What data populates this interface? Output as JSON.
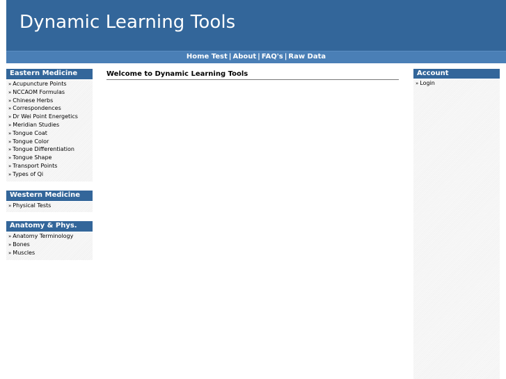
{
  "site": {
    "title": "Dynamic Learning Tools"
  },
  "nav": {
    "items": [
      {
        "label": "Home Test"
      },
      {
        "label": "About"
      },
      {
        "label": "FAQ's"
      },
      {
        "label": "Raw Data"
      }
    ],
    "separator": "|"
  },
  "sidebar_left": {
    "sections": [
      {
        "title": "Eastern Medicine",
        "items": [
          "Acupuncture Points",
          "NCCAOM Formulas",
          "Chinese Herbs",
          "Correspondences",
          "Dr Wei Point Energetics",
          "Meridian Studies",
          "Tongue Coat",
          "Tongue Color",
          "Tongue Differentiation",
          "Tongue Shape",
          "Transport Points",
          "Types of Qi"
        ]
      },
      {
        "title": "Western Medicine",
        "items": [
          "Physical Tests"
        ]
      },
      {
        "title": "Anatomy & Phys.",
        "items": [
          "Anatomy Terminology",
          "Bones",
          "Muscles"
        ]
      }
    ]
  },
  "main": {
    "heading": "Welcome to Dynamic Learning Tools"
  },
  "sidebar_right": {
    "title": "Account",
    "items": [
      "Login"
    ]
  },
  "bullet": "»",
  "colors": {
    "header_bg": "#33669a",
    "nav_bg": "#4a7fb6",
    "box_title_bg": "#33669a"
  }
}
